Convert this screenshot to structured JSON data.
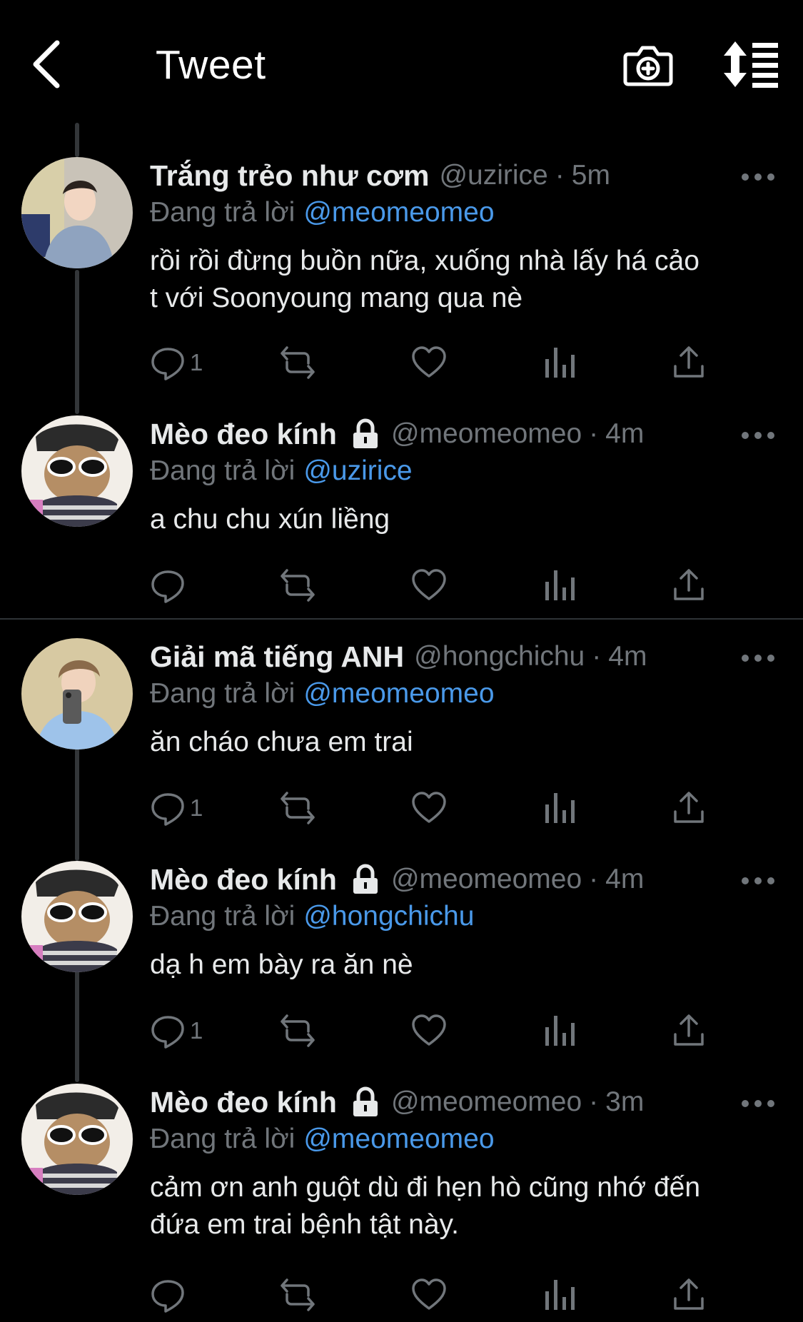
{
  "header": {
    "title": "Tweet",
    "back_icon": "chevron-left-icon",
    "camera_icon": "camera-plus-icon",
    "sort_icon": "sort-list-icon"
  },
  "reply_prefix": "Đang trả lời",
  "tweets": [
    {
      "display_name": "Trắng trẻo như cơm",
      "handle": "@uzirice",
      "time": "5m",
      "protected": false,
      "reply_to": "@meomeomeo",
      "text_lines": [
        "rồi rồi đừng buồn nữa, xuống nhà lấy há cảo",
        "t với Soonyoung mang qua nè"
      ],
      "reply_count": "1",
      "avatar": "boy-in-grey-hoodie"
    },
    {
      "display_name": "Mèo đeo kính",
      "handle": "@meomeomeo",
      "time": "4m",
      "protected": true,
      "reply_to": "@uzirice",
      "text_lines": [
        "a chu chu xún liềng"
      ],
      "reply_count": "",
      "avatar": "cat-with-sunglasses"
    },
    {
      "display_name": "Giải mã tiếng ANH",
      "handle": "@hongchichu",
      "time": "4m",
      "protected": false,
      "reply_to": "@meomeomeo",
      "text_lines": [
        "ăn cháo chưa em trai"
      ],
      "reply_count": "1",
      "avatar": "boy-mirror-selfie"
    },
    {
      "display_name": "Mèo đeo kính",
      "handle": "@meomeomeo",
      "time": "4m",
      "protected": true,
      "reply_to": "@hongchichu",
      "text_lines": [
        "dạ h em bày ra ăn nè"
      ],
      "reply_count": "1",
      "avatar": "cat-with-sunglasses"
    },
    {
      "display_name": "Mèo đeo kính",
      "handle": "@meomeomeo",
      "time": "3m",
      "protected": true,
      "reply_to": "@meomeomeo",
      "text_lines": [
        "cảm ơn anh guột dù đi hẹn hò cũng nhớ đến",
        "đứa em trai bệnh tật này."
      ],
      "reply_count": "",
      "avatar": "cat-with-sunglasses"
    }
  ],
  "colors": {
    "background": "#000000",
    "text": "#e7e9ea",
    "muted": "#71767b",
    "link": "#4a99e9",
    "divider": "#2f3336"
  }
}
